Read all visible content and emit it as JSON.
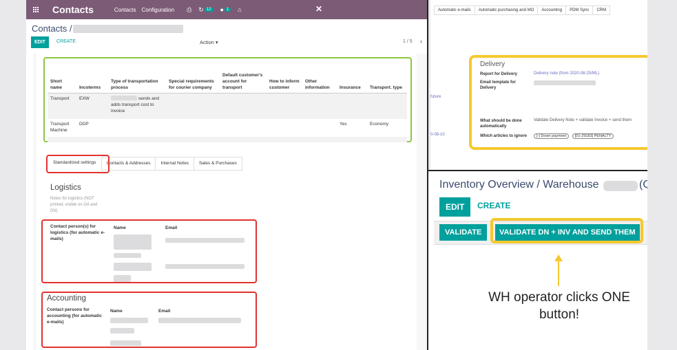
{
  "navbar": {
    "app_title": "Contacts",
    "links": [
      "Contacts",
      "Configuration"
    ],
    "chat_count": "12",
    "activity_count": "1",
    "close_symbol": "✕"
  },
  "form": {
    "breadcrumb": "Contacts /",
    "edit_label": "EDIT",
    "create_label": "CREATE",
    "action_label": "Action ▾",
    "pager": "1 / 5",
    "pager_prev": "‹"
  },
  "transport_table": {
    "headers": [
      "Short name",
      "Incoterms",
      "Type of transportation process",
      "Special requirements for courier company",
      "Default customer's account for transport",
      "How to inform customer",
      "Other information",
      "Insurance",
      "Transport. type"
    ],
    "rows": [
      {
        "short_name": "Transport",
        "incoterms": "EXW",
        "type": "sends and adds transport cost to invoice",
        "insurance": "",
        "transport_type": ""
      },
      {
        "short_name": "Transport Machine",
        "incoterms": "DDP",
        "type": "",
        "insurance": "Yes",
        "transport_type": "Economy"
      }
    ]
  },
  "tabs": [
    "Standardized settings",
    "Contacts & Addresses",
    "Internal Notes",
    "Sales & Purchases"
  ],
  "logistics": {
    "title": "Logistics",
    "note": "Notes for logistics (NOT printed; visible on OA and DN)",
    "contact_label": "Contact person(s) for logistics (for automatic e-mails)",
    "col_name": "Name",
    "col_email": "Email"
  },
  "accounting": {
    "title": "Accounting",
    "contact_label": "Contact persons for accounting (for automatic e-mails)",
    "col_name": "Name",
    "col_email": "Email"
  },
  "right_top": {
    "tabs": [
      "Automatic e-mails",
      "Automatic purchasing and MO",
      "Accounting",
      "PDM Sync",
      "CRM"
    ],
    "side_labels": [
      "future",
      "0-08-10"
    ],
    "delivery": {
      "title": "Delivery",
      "report_label": "Report for Delivery",
      "report_value": "Delivery note (from 2020-08-25/ML)",
      "template_label": "Email template for Delivery",
      "action_label": "What should be done automatically",
      "action_value": "Validate Delivery Note + validate Invoice + send them",
      "ignore_label": "Which articles to ignore",
      "ignore_tags": [
        "[-] Down payment",
        "[01-29183] PENALTY"
      ]
    }
  },
  "right_bottom": {
    "title": "Inventory Overview / Warehouse",
    "title_tail": "(Q",
    "edit_label": "EDIT",
    "create_label": "CREATE",
    "validate_label": "VALIDATE",
    "validate_dn_label": "VALIDATE DN + INV AND SEND THEM",
    "callout": "WH operator clicks ONE button!"
  },
  "colors": {
    "navbar": "#7c5b76",
    "primary": "#00a09d",
    "highlight_green": "#8cc63f",
    "highlight_red": "#e0322e",
    "highlight_yellow": "#f5c830"
  }
}
